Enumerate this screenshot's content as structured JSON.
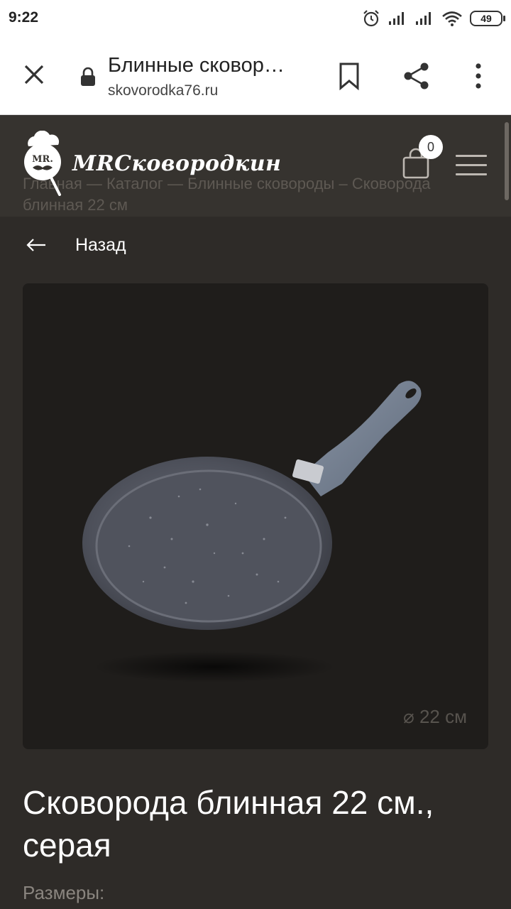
{
  "statusbar": {
    "time": "9:22",
    "battery": "49"
  },
  "browser": {
    "page_title": "Блинные сковор…",
    "domain": "skovorodka76.ru"
  },
  "site": {
    "logo_badge": "MR.",
    "brand": "MRСковородкин",
    "cart_count": "0",
    "breadcrumb": "Главная — Каталог — Блинные сковороды – Сковорода блинная 22 см"
  },
  "back_label": "Назад",
  "product": {
    "size_tag": "⌀ 22 см",
    "title": "Сковорода блинная 22 см., серая",
    "sizes_label": "Размеры:"
  },
  "colors": {
    "page_bg": "#2e2b28",
    "header_bg": "#36332f",
    "image_bg": "#1f1d1b"
  }
}
